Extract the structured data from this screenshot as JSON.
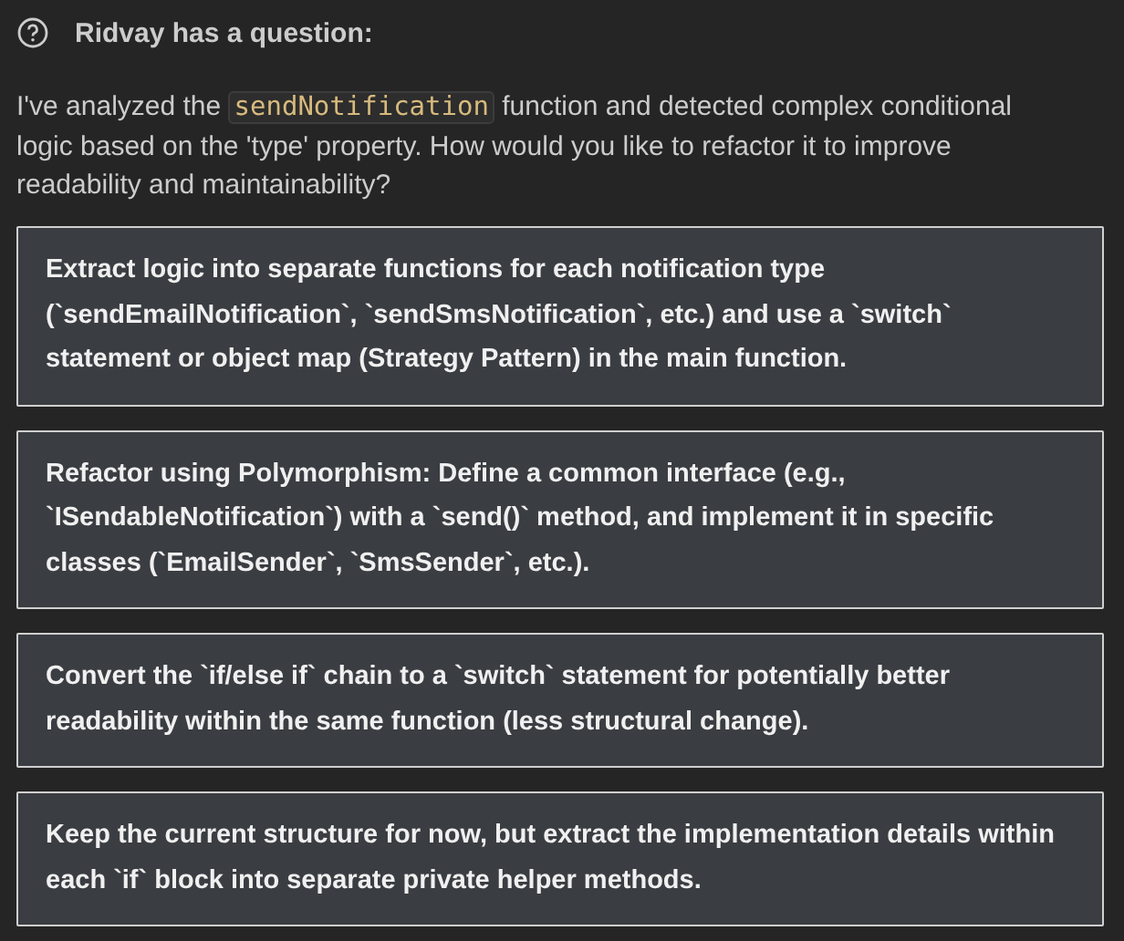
{
  "header": {
    "title": "Ridvay has a question:"
  },
  "message": {
    "before": "I've analyzed the",
    "code": "sendNotification",
    "after": "function and detected complex conditional logic based on the 'type' property. How would you like to refactor it to improve readability and maintainability?"
  },
  "options": [
    {
      "text": "Extract logic into separate functions for each notification type (`sendEmailNotification`, `sendSmsNotification`, etc.) and use a `switch` statement or object map (Strategy Pattern) in the main function."
    },
    {
      "text": "Refactor using Polymorphism: Define a common interface (e.g., `ISendableNotification`) with a `send()` method, and implement it in specific classes (`EmailSender`, `SmsSender`, etc.)."
    },
    {
      "text": "Convert the `if/else if` chain to a `switch` statement for potentially better readability within the same function (less structural change)."
    },
    {
      "text": "Keep the current structure for now, but extract the implementation details within each `if` block into separate private helper methods."
    }
  ]
}
